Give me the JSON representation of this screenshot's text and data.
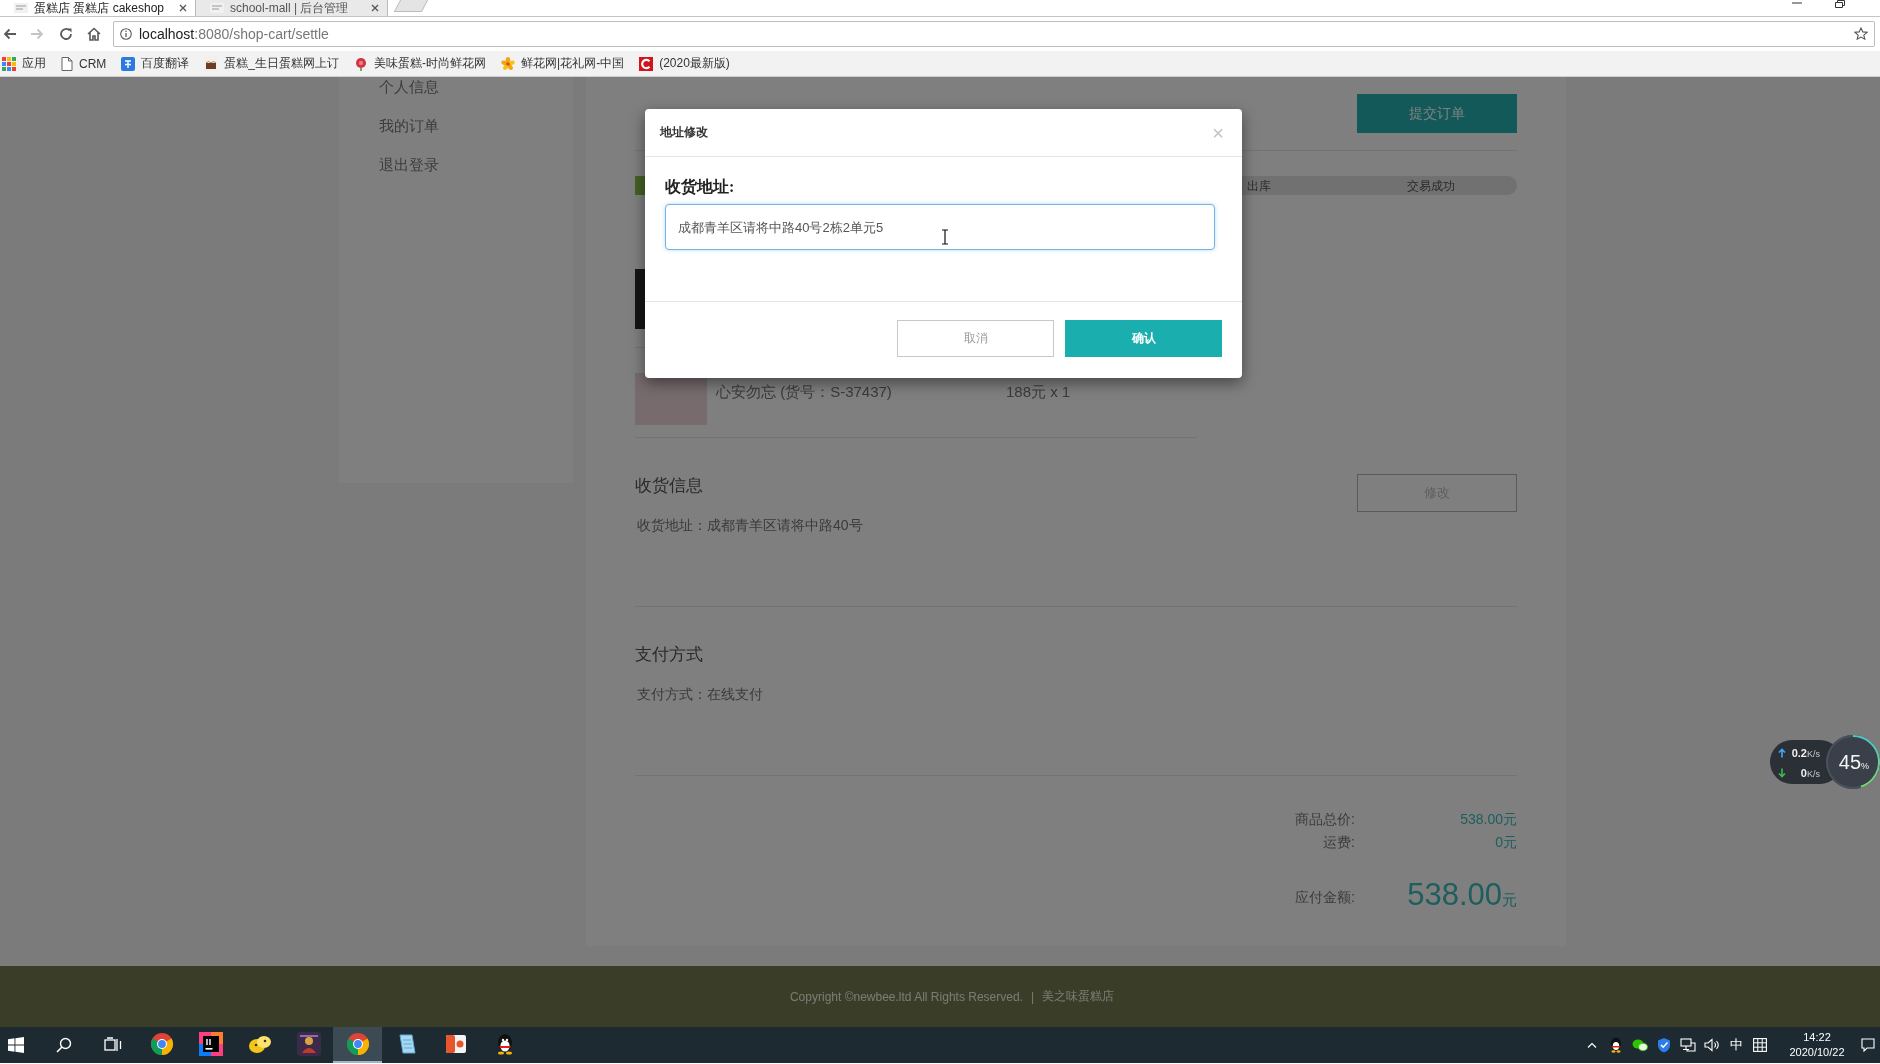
{
  "browser": {
    "tabs": [
      {
        "title": "蛋糕店 蛋糕店 cakeshop",
        "selected": true
      },
      {
        "title": "school-mall | 后台管理",
        "selected": false
      }
    ],
    "nav_buttons": [
      {
        "kind": "back",
        "disabled": false
      },
      {
        "kind": "forward",
        "disabled": true
      },
      {
        "kind": "reload",
        "disabled": false
      },
      {
        "kind": "home",
        "disabled": false
      }
    ],
    "url": {
      "host": "localhost",
      "path": ":8080/shop-cart/settle"
    },
    "bookmarks": [
      {
        "kind": "apps",
        "label": "应用"
      },
      {
        "kind": "page",
        "label": "CRM"
      },
      {
        "kind": "translate",
        "label": "百度翻译"
      },
      {
        "kind": "cake",
        "label": "蛋糕_生日蛋糕网上订"
      },
      {
        "kind": "rose",
        "label": "美味蛋糕-时尚鲜花网"
      },
      {
        "kind": "flower",
        "label": "鲜花网|花礼网-中国"
      },
      {
        "kind": "c_logo",
        "label": "(2020最新版)"
      }
    ]
  },
  "sidebar": {
    "items": [
      {
        "label": "个人信息"
      },
      {
        "label": "我的订单"
      },
      {
        "label": "退出登录"
      }
    ]
  },
  "order": {
    "submit_button": "提交订单",
    "progress": {
      "level": 0.2,
      "steps": [
        {
          "label": "出库"
        },
        {
          "label": "交易成功"
        }
      ]
    },
    "products": [
      {
        "kind": "thumbnail_only"
      },
      {
        "kind": "full",
        "name": "心安勿忘 (货号：S-37437)",
        "price": "188元 x 1"
      }
    ],
    "shipping": {
      "title": "收货信息",
      "edit_button": "修改",
      "address": "收货地址：成都青羊区请将中路40号"
    },
    "payment": {
      "title": "支付方式",
      "method": "支付方式：在线支付"
    },
    "totals": [
      {
        "label": "商品总价:",
        "value": "538.00元"
      },
      {
        "label": "运费:",
        "value": "0元"
      }
    ],
    "amount_due": {
      "label": "应付金额:",
      "value": "538.00",
      "unit": "元"
    }
  },
  "footer": {
    "copyright": "Copyright ©newbee.ltd All Rights Reserved.",
    "separator": "|",
    "link": "美之味蛋糕店"
  },
  "dialog": {
    "title": "地址修改",
    "close": "×",
    "field_label": "收货地址:",
    "field_value": "成都青羊区请将中路40号2栋2单元5",
    "focused": true,
    "buttons": [
      {
        "kind": "secondary",
        "label": "取消"
      },
      {
        "kind": "primary",
        "label": "确认"
      }
    ]
  },
  "speed_widget": {
    "upload": {
      "value": "0.2",
      "unit": "K/s"
    },
    "download": {
      "value": "0",
      "unit": "K/s"
    },
    "usage": {
      "value": "45",
      "unit": "%",
      "level": 0.45
    }
  },
  "taskbar": {
    "apps": [
      {
        "kind": "browser",
        "selected": false
      },
      {
        "kind": "ide",
        "selected": false
      },
      {
        "kind": "cartoon",
        "selected": false
      },
      {
        "kind": "game",
        "selected": false
      },
      {
        "kind": "browser",
        "selected": true
      },
      {
        "kind": "notepad",
        "selected": false
      },
      {
        "kind": "slides",
        "selected": false
      },
      {
        "kind": "penguin",
        "selected": false
      }
    ],
    "tray": {
      "ime": "中",
      "time": "14:22",
      "date": "2020/10/22"
    }
  }
}
